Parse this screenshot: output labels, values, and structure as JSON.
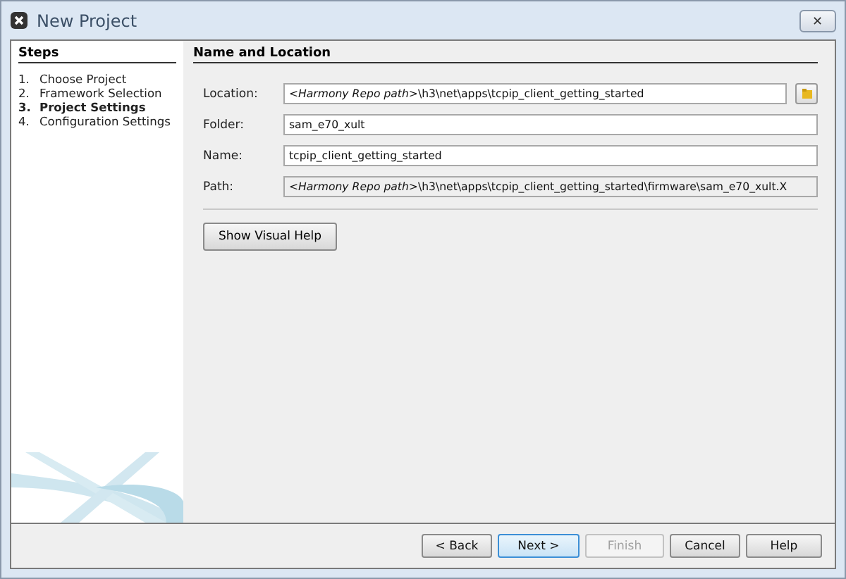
{
  "window": {
    "title": "New Project",
    "close_label": "✕"
  },
  "steps": {
    "title": "Steps",
    "items": [
      {
        "number": "1.",
        "label": "Choose Project",
        "selected": false
      },
      {
        "number": "2.",
        "label": "Framework Selection",
        "selected": false
      },
      {
        "number": "3.",
        "label": "Project Settings",
        "selected": true
      },
      {
        "number": "4.",
        "label": "Configuration Settings",
        "selected": false
      }
    ]
  },
  "panel": {
    "title": "Name and Location",
    "fields": [
      {
        "label": "Location:",
        "value": "*<Harmony Repo path>*\\h3\\net\\apps\\tcpip_client_getting_started",
        "kind": "browse",
        "disabled": false
      },
      {
        "label": "Folder:",
        "value": "sam_e70_xult",
        "kind": "text",
        "disabled": false
      },
      {
        "label": "Name:",
        "value": "tcpip_client_getting_started",
        "kind": "text",
        "disabled": false
      },
      {
        "label": "Path:",
        "value": "*<Harmony Repo path>*\\h3\\net\\apps\\tcpip_client_getting_started\\firmware\\sam_e70_xult.X",
        "kind": "text",
        "disabled": true
      }
    ],
    "help_button": "Show Visual Help"
  },
  "buttons": [
    {
      "label": "< Back",
      "default": false,
      "disabled": false
    },
    {
      "label": "Next >",
      "default": true,
      "disabled": false
    },
    {
      "label": "Finish",
      "default": false,
      "disabled": true
    },
    {
      "label": "Cancel",
      "default": false,
      "disabled": false
    },
    {
      "label": "Help",
      "default": false,
      "disabled": false
    }
  ]
}
